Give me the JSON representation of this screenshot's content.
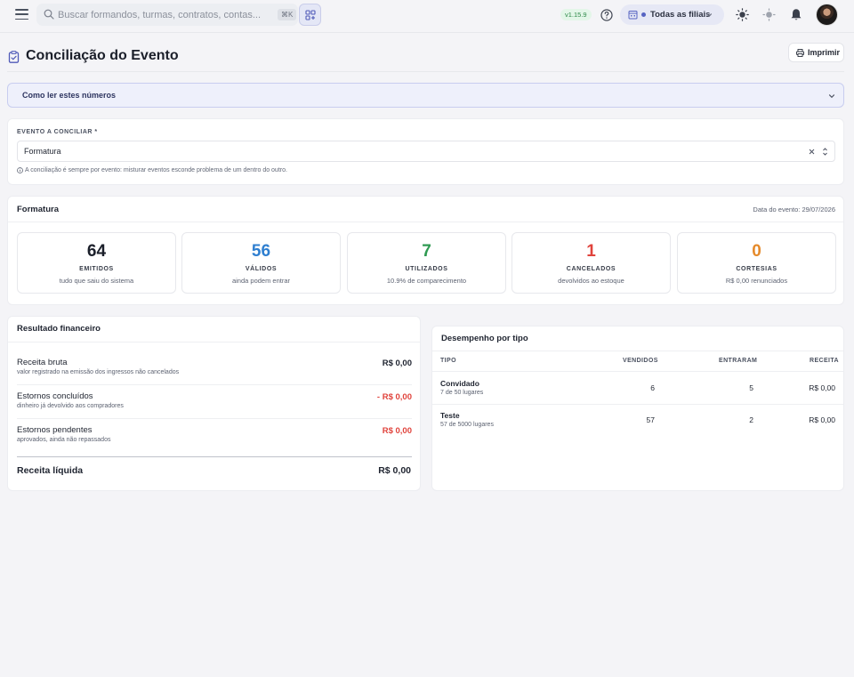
{
  "topbar": {
    "search_placeholder": "Buscar formandos, turmas, contratos, contas...",
    "search_shortcut": "⌘K",
    "version": "v1.15.9",
    "branch_label": "Todas as filiais"
  },
  "page": {
    "title": "Conciliação do Evento",
    "print_label": "Imprimir"
  },
  "accordion": {
    "label": "Como ler estes números"
  },
  "event_select": {
    "label": "EVENTO A CONCILIAR *",
    "value": "Formatura",
    "hint": "A conciliação é sempre por evento: misturar eventos esconde problema de um dentro do outro."
  },
  "stats": {
    "title": "Formatura",
    "date": "Data do evento: 29/07/2026",
    "items": [
      {
        "value": "64",
        "label": "EMITIDOS",
        "sub": "tudo que saiu do sistema",
        "color": "#1b1f2a"
      },
      {
        "value": "56",
        "label": "VÁLIDOS",
        "sub": "ainda podem entrar",
        "color": "#2f7fd0"
      },
      {
        "value": "7",
        "label": "UTILIZADOS",
        "sub": "10.9% de comparecimento",
        "color": "#2f9a52"
      },
      {
        "value": "1",
        "label": "CANCELADOS",
        "sub": "devolvidos ao estoque",
        "color": "#e0433c"
      },
      {
        "value": "0",
        "label": "CORTESIAS",
        "sub": "R$ 0,00 renunciados",
        "color": "#e58a2b"
      }
    ]
  },
  "financial": {
    "title": "Resultado financeiro",
    "rows": [
      {
        "label": "Receita bruta",
        "sub": "valor registrado na emissão dos ingressos não cancelados",
        "value": "R$ 0,00",
        "color": "#1f2430"
      },
      {
        "label": "Estornos concluídos",
        "sub": "dinheiro já devolvido aos compradores",
        "value": "- R$ 0,00",
        "color": "#e0433c"
      },
      {
        "label": "Estornos pendentes",
        "sub": "aprovados, ainda não repassados",
        "value": "R$ 0,00",
        "color": "#e0433c"
      }
    ],
    "total_label": "Receita líquida",
    "total_value": "R$ 0,00"
  },
  "performance": {
    "title": "Desempenho por tipo",
    "columns": [
      "TIPO",
      "VENDIDOS",
      "ENTRARAM",
      "RECEITA"
    ],
    "rows": [
      {
        "name": "Convidado",
        "capacity": "7 de 50 lugares",
        "sold": "6",
        "entered": "5",
        "revenue": "R$ 0,00"
      },
      {
        "name": "Teste",
        "capacity": "57 de 5000 lugares",
        "sold": "57",
        "entered": "2",
        "revenue": "R$ 0,00"
      }
    ]
  }
}
